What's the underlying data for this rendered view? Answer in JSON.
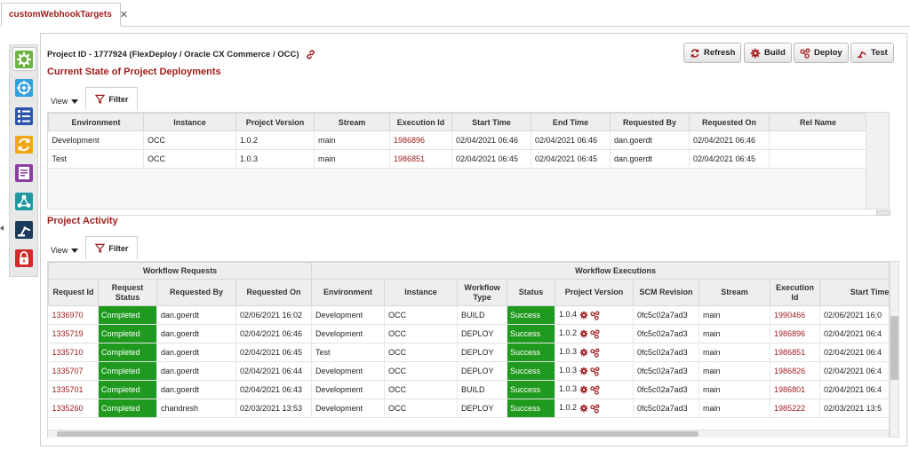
{
  "tab": {
    "title": "customWebhookTargets",
    "close": "✕"
  },
  "project_title": "Project ID - 1777924 (FlexDeploy / Oracle CX Commerce / OCC)",
  "toolbar": {
    "refresh": "Refresh",
    "build": "Build",
    "deploy": "Deploy",
    "test": "Test"
  },
  "deployments": {
    "title": "Current State of Project Deployments",
    "view_label": "View",
    "filter_label": "Filter",
    "columns": [
      "Environment",
      "Instance",
      "Project Version",
      "Stream",
      "Execution Id",
      "Start Time",
      "End Time",
      "Requested By",
      "Requested On",
      "Rel Name"
    ],
    "rows": [
      [
        "Development",
        "OCC",
        "1.0.2",
        "main",
        "1986896",
        "02/04/2021 06:46",
        "02/04/2021 06:46",
        "dan.goerdt",
        "02/04/2021 06:46",
        ""
      ],
      [
        "Test",
        "OCC",
        "1.0.3",
        "main",
        "1986851",
        "02/04/2021 06:45",
        "02/04/2021 06:45",
        "dan.goerdt",
        "02/04/2021 06:45",
        ""
      ]
    ]
  },
  "activity": {
    "title": "Project Activity",
    "view_label": "View",
    "filter_label": "Filter",
    "group_requests": "Workflow Requests",
    "group_executions": "Workflow Executions",
    "columns": [
      "Request Id",
      "Request Status",
      "Requested By",
      "Requested On",
      "Environment",
      "Instance",
      "Workflow Type",
      "Status",
      "Project Version",
      "SCM Revision",
      "Stream",
      "Execution Id",
      "Start Time"
    ],
    "rows": [
      [
        "1336970",
        "Completed",
        "dan.goerdt",
        "02/06/2021 16:02",
        "Development",
        "OCC",
        "BUILD",
        "Success",
        "1.0.4",
        "0fc5c02a7ad3",
        "main",
        "1990466",
        "02/06/2021 16:0"
      ],
      [
        "1335719",
        "Completed",
        "dan.goerdt",
        "02/04/2021 06:46",
        "Development",
        "OCC",
        "DEPLOY",
        "Success",
        "1.0.2",
        "0fc5c02a7ad3",
        "main",
        "1986896",
        "02/04/2021 06:4"
      ],
      [
        "1335710",
        "Completed",
        "dan.goerdt",
        "02/04/2021 06:45",
        "Test",
        "OCC",
        "DEPLOY",
        "Success",
        "1.0.3",
        "0fc5c02a7ad3",
        "main",
        "1986851",
        "02/04/2021 06:4"
      ],
      [
        "1335707",
        "Completed",
        "dan.goerdt",
        "02/04/2021 06:44",
        "Development",
        "OCC",
        "DEPLOY",
        "Success",
        "1.0.3",
        "0fc5c02a7ad3",
        "main",
        "1986826",
        "02/04/2021 06:4"
      ],
      [
        "1335701",
        "Completed",
        "dan.goerdt",
        "02/04/2021 06:43",
        "Development",
        "OCC",
        "BUILD",
        "Success",
        "1.0.3",
        "0fc5c02a7ad3",
        "main",
        "1986801",
        "02/04/2021 06:4"
      ],
      [
        "1335260",
        "Completed",
        "chandresh",
        "02/03/2021 13:53",
        "Development",
        "OCC",
        "DEPLOY",
        "Success",
        "1.0.2",
        "0fc5c02a7ad3",
        "main",
        "1985222",
        "02/03/2021 13:5"
      ]
    ]
  },
  "colors": {
    "accent": "#a01e1e",
    "success": "#1f9a1f"
  },
  "rail_icons": [
    "overview-icon",
    "target-icon",
    "properties-icon",
    "refresh-cycle-icon",
    "report-icon",
    "topology-icon",
    "robot-arm-icon",
    "lock-icon"
  ]
}
